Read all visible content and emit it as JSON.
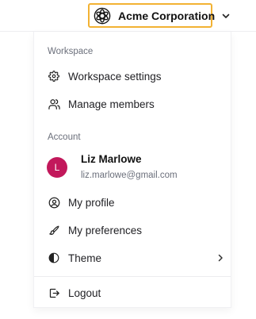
{
  "header": {
    "org_name": "Acme Corporation",
    "org_logo_icon": "org-logo-icon",
    "switcher_chevron_icon": "chevron-down-icon",
    "highlight_color": "#f2b233"
  },
  "menu": {
    "workspace_section": {
      "title": "Workspace",
      "items": [
        {
          "label": "Workspace settings",
          "icon": "gear-icon"
        },
        {
          "label": "Manage members",
          "icon": "users-icon"
        }
      ]
    },
    "account_section": {
      "title": "Account",
      "user": {
        "avatar_initial": "L",
        "avatar_color": "#c2185b",
        "name": "Liz Marlowe",
        "email": "liz.marlowe@gmail.com"
      },
      "items": [
        {
          "label": "My profile",
          "icon": "user-circle-icon"
        },
        {
          "label": "My preferences",
          "icon": "brush-icon"
        },
        {
          "label": "Theme",
          "icon": "contrast-icon",
          "submenu_icon": "chevron-right-icon"
        }
      ]
    },
    "logout": {
      "label": "Logout",
      "icon": "logout-icon"
    }
  }
}
